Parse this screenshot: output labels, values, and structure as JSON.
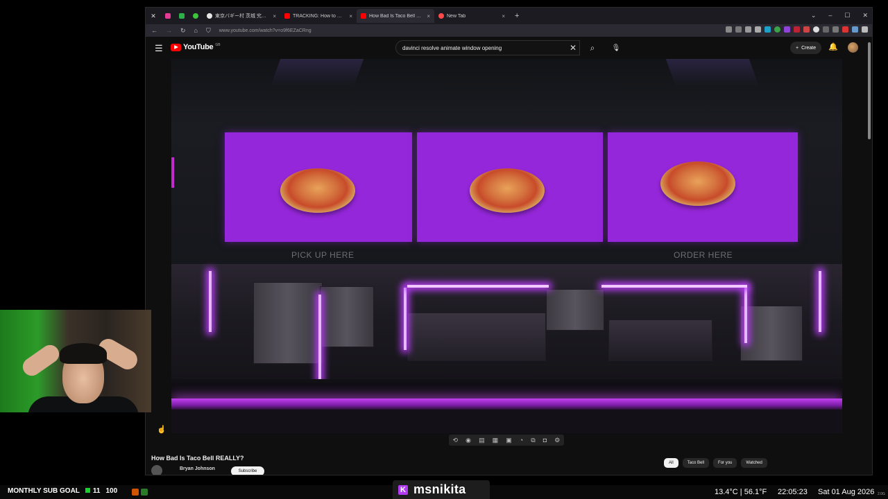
{
  "browser": {
    "tabs": [
      {
        "label": "",
        "fav": "#e33b93"
      },
      {
        "label": "",
        "fav": "#2bb04a"
      },
      {
        "label": "",
        "fav": "#3ec33c"
      },
      {
        "label": "東京バギー村 茨城 究極に…",
        "fav": "#e6e6e6"
      },
      {
        "label": "TRACKING: How to Stick an IMA…",
        "fav": "#ff0000"
      },
      {
        "label": "How Bad Is Taco Bell REALL…",
        "fav": "#ff0000"
      },
      {
        "label": "New Tab",
        "fav": "#ff4a4a"
      }
    ],
    "close_glyph": "×",
    "new_tab_glyph": "+",
    "url": "www.youtube.com/watch?v=o9f6EZaCRng",
    "window_controls": [
      "⌄",
      "–",
      "☐",
      "✕"
    ]
  },
  "youtube": {
    "logo_text": "YouTube",
    "logo_superscript": "GB",
    "search_value": "davinci resolve animate window opening",
    "create_label": "Create",
    "video": {
      "sign_left": "PICK UP HERE",
      "sign_right": "ORDER HERE"
    },
    "video_title": "How Bad Is Taco Bell REALLY?",
    "channel_name": "Bryan Johnson",
    "subscribe_label": "Subscribe",
    "chips": [
      "All",
      "Taco Bell",
      "For you",
      "Watched"
    ]
  },
  "overlay": {
    "sub_goal_label": "MONTHLY SUB GOAL",
    "sub_goal_current": "11",
    "sub_goal_target": "100",
    "streamer_name": "msnikita",
    "streamer_badge": "K",
    "temperature": "13.4°C | 56.1°F",
    "time": "22:05:23",
    "date": "Sat 01 Aug 2026",
    "extra": "2.0G"
  },
  "colors": {
    "menu_panel": "#9427d9",
    "neon": "#b63df5",
    "yt_red": "#ff0000",
    "goal_green": "#18d22b"
  }
}
